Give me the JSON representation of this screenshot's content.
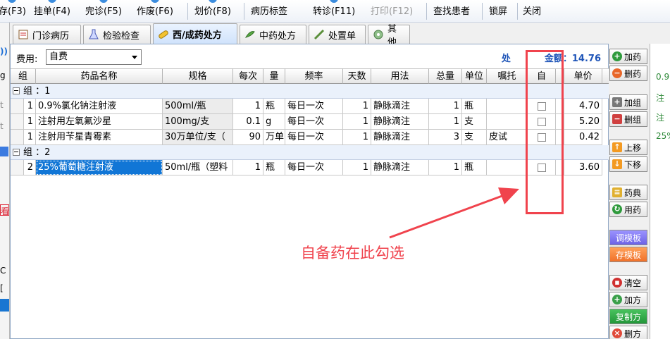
{
  "toolbar": {
    "items": [
      "存(F3)",
      "挂单(F4)",
      "完诊(F5)",
      "作废(F6)",
      "划价(F8)",
      "病历标签",
      "转诊(F11)",
      "打印(F12)",
      "查找患者",
      "锁屏",
      "关闭"
    ]
  },
  "left_edge": {
    "items": [
      "))",
      "g",
      "t",
      "t",
      "看",
      "C",
      "["
    ]
  },
  "tabs": [
    {
      "label": "门诊病历"
    },
    {
      "label": "检验检查"
    },
    {
      "label": "西/成药处方"
    },
    {
      "label": "中药处方"
    },
    {
      "label": "处置单"
    },
    {
      "label": "其他"
    }
  ],
  "fee": {
    "label": "费用:",
    "value": "自费"
  },
  "total": {
    "label_visible": "处",
    "label_tail": "金额：14.76"
  },
  "columns": [
    "组",
    "药品名称",
    "规格",
    "每次",
    "量",
    "频率",
    "天数",
    "用法",
    "总量",
    "单位",
    "嘱托",
    "自",
    "单价"
  ],
  "groups": [
    {
      "label": "组 ：1",
      "rows": [
        {
          "group": "1",
          "name": "0.9%氯化钠注射液",
          "spec": "500ml/瓶",
          "dose": "1",
          "unit1": "瓶",
          "freq": "每日一次",
          "days": "1",
          "usage": "静脉滴注",
          "qty": "1",
          "unit2": "瓶",
          "note": "",
          "price": "4.70"
        },
        {
          "group": "1",
          "name": "注射用左氧氟沙星",
          "spec": "100mg/支",
          "dose": "0.1",
          "unit1": "g",
          "freq": "每日一次",
          "days": "1",
          "usage": "静脉滴注",
          "qty": "1",
          "unit2": "支",
          "note": "",
          "price": "5.20"
        },
        {
          "group": "1",
          "name": "注射用苄星青霉素",
          "spec": "30万单位/支（",
          "dose": "90",
          "unit1": "万单",
          "freq": "每日一次",
          "days": "1",
          "usage": "静脉滴注",
          "qty": "3",
          "unit2": "支",
          "note": "皮试",
          "price": "0.42"
        }
      ]
    },
    {
      "label": "组 ：2",
      "rows": [
        {
          "group": "2",
          "name": "25%葡萄糖注射液",
          "spec": "50ml/瓶（塑料",
          "dose": "1",
          "unit1": "瓶",
          "freq": "每日一次",
          "days": "1",
          "usage": "静脉滴注",
          "qty": "1",
          "unit2": "瓶",
          "note": "",
          "price": "3.60"
        }
      ]
    }
  ],
  "annotation": {
    "text": "自备药在此勾选",
    "color": "#f0434d"
  },
  "right_buttons": [
    {
      "label": "加药",
      "icon": "plus-icon",
      "color": "#2e9a3c"
    },
    {
      "label": "删药",
      "icon": "minus-icon",
      "color": "#e8672a"
    },
    {
      "label": "加组",
      "icon": "add-group-icon",
      "color": "#5a5a5a"
    },
    {
      "label": "删组",
      "icon": "delete-group-icon",
      "color": "#d04040"
    },
    {
      "label": "上移",
      "icon": "arrow-up-icon",
      "color": "#f39a22"
    },
    {
      "label": "下移",
      "icon": "arrow-down-icon",
      "color": "#f39a22"
    },
    {
      "label": "药典",
      "icon": "book-icon",
      "color": "#e0b030"
    },
    {
      "label": "用药",
      "icon": "refresh-icon",
      "color": "#2e9a3c"
    },
    {
      "label": "调模板",
      "style": "purple"
    },
    {
      "label": "存模板",
      "style": "orange"
    },
    {
      "label": "清空",
      "icon": "trash-icon",
      "color": "#d03030"
    },
    {
      "label": "加方",
      "icon": "plus-circle-icon",
      "color": "#3aa04a"
    },
    {
      "label": "复制方",
      "style": "green"
    },
    {
      "label": "删方",
      "icon": "close-circle-icon",
      "color": "#e04a3a"
    }
  ],
  "far_right": {
    "items": [
      "0.9",
      "注",
      "注",
      "25%"
    ]
  }
}
